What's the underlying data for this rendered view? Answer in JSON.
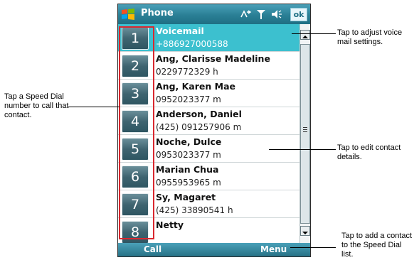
{
  "window": {
    "title": "Phone",
    "ok_label": "ok"
  },
  "contacts": [
    {
      "speed": "1",
      "name": "Voicemail",
      "number": "+886927000588",
      "selected": true
    },
    {
      "speed": "2",
      "name": "Ang, Clarisse Madeline",
      "number": "0229772329 h"
    },
    {
      "speed": "3",
      "name": "Ang, Karen Mae",
      "number": "0952023377 m"
    },
    {
      "speed": "4",
      "name": "Anderson, Daniel",
      "number": "(425) 091257906 m"
    },
    {
      "speed": "5",
      "name": "Noche, Dulce",
      "number": "0953023377 m"
    },
    {
      "speed": "6",
      "name": "Marian Chua",
      "number": "0955953965 m"
    },
    {
      "speed": "7",
      "name": "Sy, Magaret",
      "number": "(425) 33890541 h"
    },
    {
      "speed": "8",
      "name": "Netty",
      "number": ""
    }
  ],
  "softkeys": {
    "left": "Call",
    "right": "Menu"
  },
  "callouts": {
    "voicemail": "Tap to adjust voice mail settings.",
    "speed_dial": "Tap a Speed Dial number to call that contact.",
    "edit_contact": "Tap to edit contact details.",
    "add_speed_dial": "Tap to add a contact to the Speed Dial list."
  },
  "colors": {
    "title_bar": "#2a7f95",
    "selected_row": "#3cc0cf",
    "speed_dial_frame": "#d9282f"
  }
}
